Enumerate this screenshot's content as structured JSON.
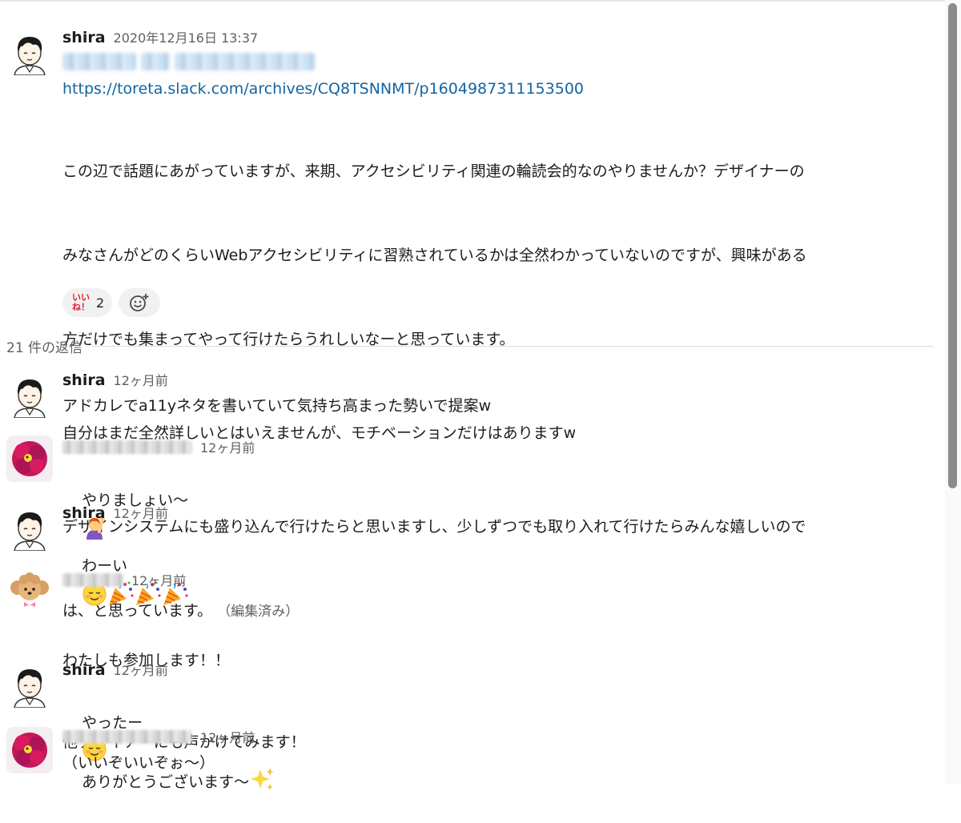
{
  "parent": {
    "sender": "shira",
    "timestamp": "2020年12月16日 13:37",
    "link": "https://toreta.slack.com/archives/CQ8TSNNMT/p1604987311153500",
    "paragraph1_line1": "この辺で話題にあがっていますが、来期、アクセシビリティ関連の輪読会的なのやりませんか？デザイナーの",
    "paragraph1_line2": "みなさんがどのくらいWebアクセシビリティに習熟されているかは全然わかっていないのですが、興味がある",
    "paragraph1_line3": "方だけでも集まってやって行けたらうれしいなーと思っています。",
    "paragraph2": "自分はまだ全然詳しいとはいえませんが、モチベーションだけはありますw",
    "paragraph3_line1": "デザインシステムにも盛り込んで行けたらと思いますし、少しずつでも取り入れて行けたらみんな嬉しいので",
    "paragraph3_line2": "は、と思っています。",
    "edited": "（編集済み）",
    "reaction": {
      "emoji_line1": "いい",
      "emoji_line2": "ね！",
      "count": "2",
      "icon": "iine-emoji"
    },
    "add_reaction_icon": "add-reaction-icon"
  },
  "replies_label": "21 件の返信",
  "replies": [
    {
      "sender": "shira",
      "time": "12ヶ月前",
      "text": "アドカレでa11yネタを書いていて気持ち高まった勢いで提案w"
    },
    {
      "sender": "",
      "time": "12ヶ月前",
      "text": "やりましょい〜",
      "emoji": "raising-hand-emoji"
    },
    {
      "sender": "shira",
      "time": "12ヶ月前",
      "text": "わーい",
      "emoji": "relieved-face-and-party-popper-emoji"
    },
    {
      "sender": "",
      "time": "12ヶ月前",
      "text_line1": "わたしも参加します！！",
      "text_line2": "他デザイナーにも声かけてみます！"
    },
    {
      "sender": "shira",
      "time": "12ヶ月前",
      "text_before": "やったー",
      "text_after": "ありがとうございます〜",
      "emoji": "sparkles-emoji"
    },
    {
      "sender": "",
      "time": "12ヶ月前",
      "text": "（いいぞいいぞぉ〜）"
    }
  ],
  "colors": {
    "link": "#1264a3",
    "meta": "#616061",
    "text": "#1d1c1d"
  }
}
